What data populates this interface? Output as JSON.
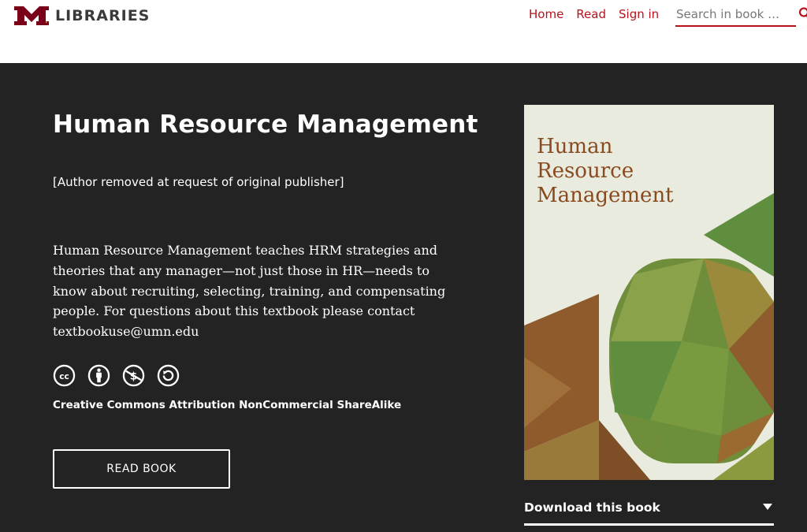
{
  "header": {
    "logo_text": "LIBRARIES",
    "nav": [
      "Home",
      "Read",
      "Sign in"
    ],
    "search_placeholder": "Search in book …",
    "accent_color": "#b5121b",
    "logo_mark_color": "#7a0019"
  },
  "book": {
    "title": "Human Resource Management",
    "author": "[Author removed at request of original publisher]",
    "description": "Human Resource Management teaches HRM strategies and theories that any manager—not just those in HR—needs to know about recruiting, selecting, training, and compensating people. For questions about this textbook please contact textbookuse@umn.edu",
    "license_icons": [
      "cc-icon",
      "attribution-icon",
      "noncommercial-icon",
      "sharealike-icon"
    ],
    "license": "Creative Commons Attribution NonCommercial ShareAlike",
    "read_button": "READ BOOK",
    "cover_title_lines": [
      "Human",
      "Resource",
      "Management"
    ],
    "download_label": "Download this book"
  },
  "colors": {
    "hero_bg": "#232323",
    "cover_bg": "#e8ebde",
    "cover_title": "#8a4a1f"
  }
}
